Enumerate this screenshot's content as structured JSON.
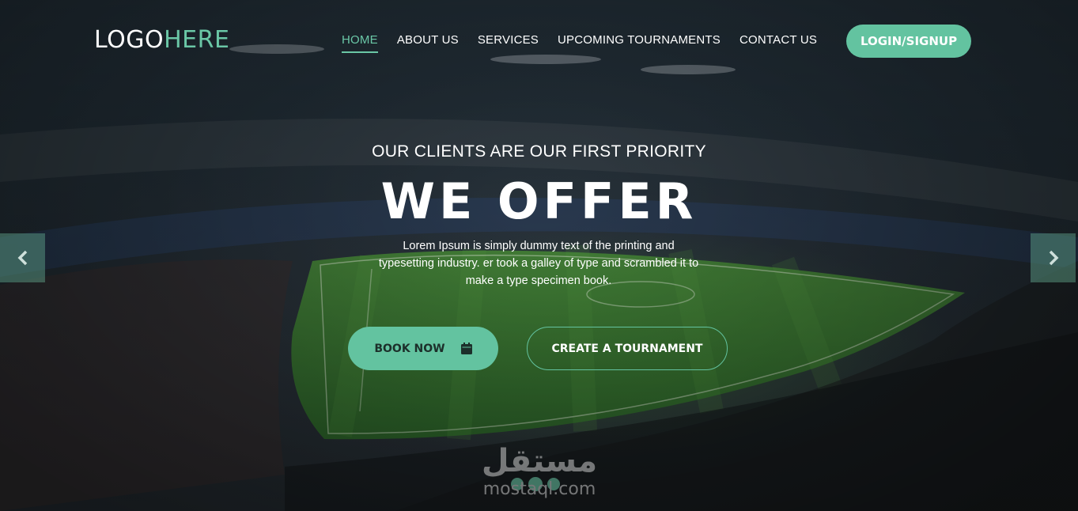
{
  "header": {
    "logo": {
      "primary": "LOGO",
      "accent": "HERE"
    },
    "nav": [
      {
        "label": "HOME",
        "active": true
      },
      {
        "label": "ABOUT US",
        "active": false
      },
      {
        "label": "SERVICES",
        "active": false
      },
      {
        "label": "UPCOMING TOURNAMENTS",
        "active": false
      },
      {
        "label": "CONTACT US",
        "active": false
      }
    ],
    "login_label": "LOGIN/SIGNUP"
  },
  "hero": {
    "tagline": "OUR CLIENTS ARE OUR FIRST PRIORITY",
    "headline": "WE OFFER",
    "description": "Lorem Ipsum is simply dummy text of the printing and typesetting industry. er took a galley of type and scrambled it to make a type specimen book.",
    "book_label": "BOOK NOW",
    "create_label": "CREATE A TOURNAMENT"
  },
  "slider": {
    "prev_icon": "chevron-left-icon",
    "next_icon": "chevron-right-icon"
  },
  "watermark": {
    "arabic": "مستقل",
    "latin": "mostaql.com"
  },
  "colors": {
    "accent": "#63c3a0",
    "text": "#ffffff",
    "button_text_dark": "#1c2f2a"
  }
}
